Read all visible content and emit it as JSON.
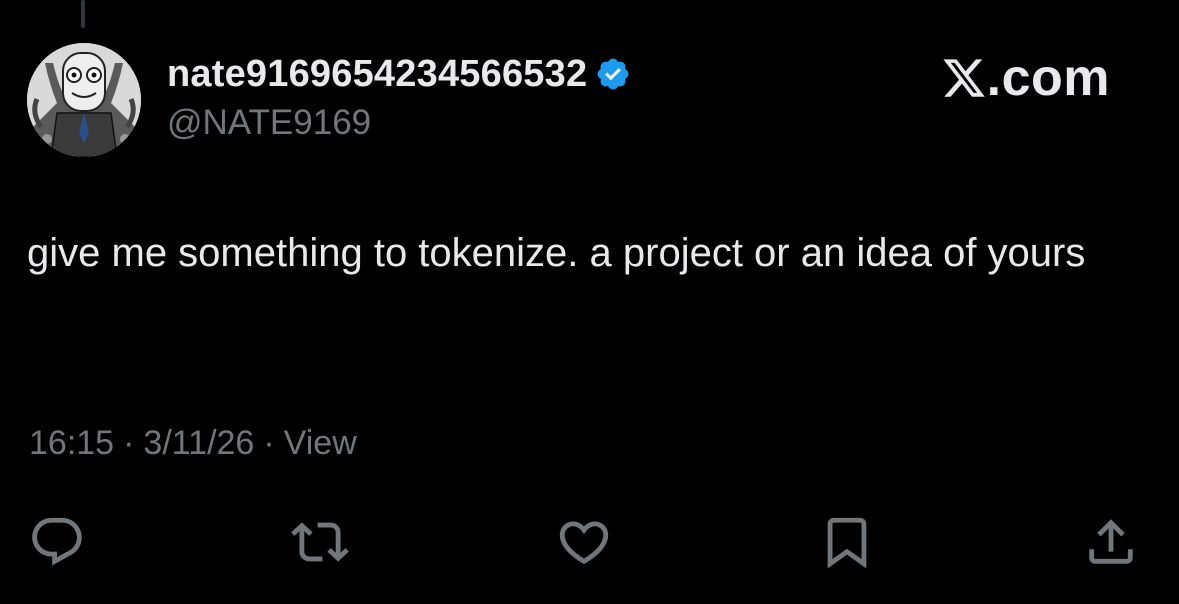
{
  "author": {
    "display_name": "nate9169654234566532",
    "handle": "@NATE9169",
    "verified": true
  },
  "brand": {
    "label": ".com"
  },
  "tweet": {
    "text": "give me something to tokenize. a project or an idea of yours"
  },
  "meta": {
    "time": "16:15",
    "separator": "·",
    "date": "3/11/26",
    "views_label": "View"
  },
  "actions": [
    {
      "icon": "reply-icon"
    },
    {
      "icon": "retweet-icon"
    },
    {
      "icon": "like-icon"
    },
    {
      "icon": "bookmark-icon"
    },
    {
      "icon": "share-icon"
    }
  ],
  "colors": {
    "background": "#000000",
    "text_primary": "#e7e9ea",
    "text_secondary": "#71767b",
    "verified_blue": "#1d9bf0",
    "icon_gray": "#71767b"
  }
}
